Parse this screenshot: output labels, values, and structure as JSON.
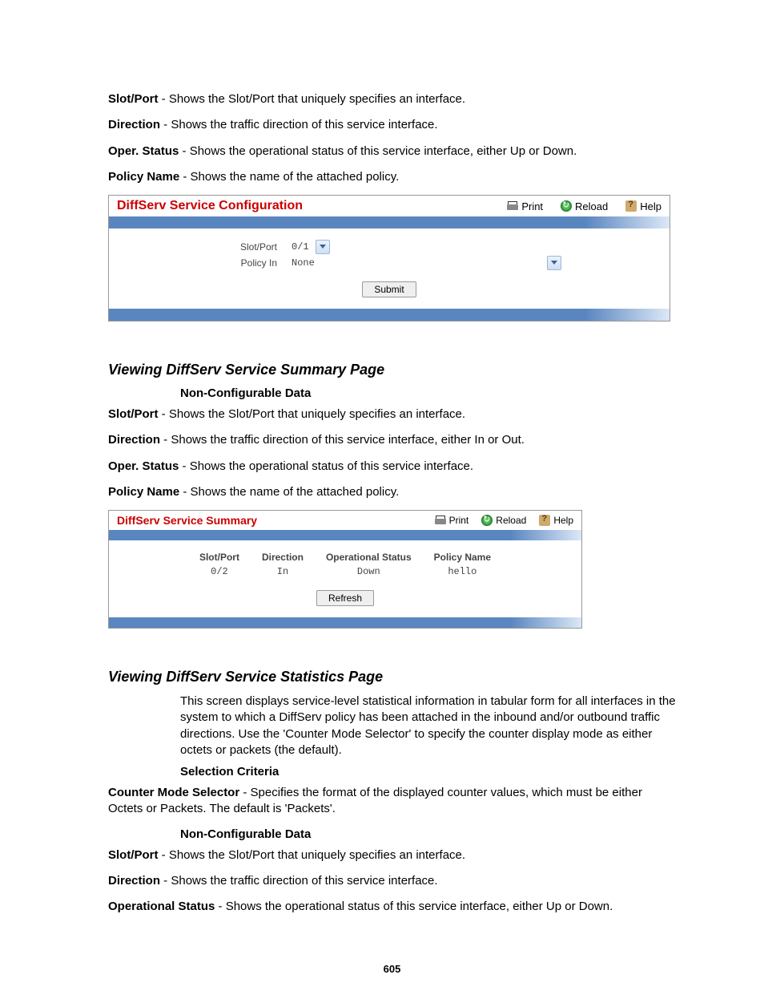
{
  "defs1": [
    {
      "term": "Slot/Port",
      "desc": " - Shows the Slot/Port that uniquely specifies an interface."
    },
    {
      "term": "Direction",
      "desc": " - Shows the traffic direction of this service interface."
    },
    {
      "term": "Oper. Status",
      "desc": " - Shows the operational status of this service interface, either Up or Down."
    },
    {
      "term": "Policy Name",
      "desc": " - Shows the name of the attached policy."
    }
  ],
  "panel_config": {
    "title": "DiffServ Service Configuration",
    "actions": {
      "print": "Print",
      "reload": "Reload",
      "help": "Help"
    },
    "rows": {
      "slotport_label": "Slot/Port",
      "slotport_value": "0/1",
      "policyin_label": "Policy In",
      "policyin_value": "None"
    },
    "submit": "Submit"
  },
  "section_summary": {
    "heading": "Viewing DiffServ Service Summary Page",
    "subhead": "Non-Configurable Data",
    "defs": [
      {
        "term": "Slot/Port",
        "desc": " - Shows the Slot/Port that uniquely specifies an interface."
      },
      {
        "term": "Direction",
        "desc": " - Shows the traffic direction of this service interface, either In or Out."
      },
      {
        "term": "Oper. Status",
        "desc": " - Shows the operational status of this service interface."
      },
      {
        "term": "Policy Name",
        "desc": " - Shows the name of the attached policy."
      }
    ]
  },
  "panel_summary": {
    "title": "DiffServ Service Summary",
    "actions": {
      "print": "Print",
      "reload": "Reload",
      "help": "Help"
    },
    "headers": {
      "c1": "Slot/Port",
      "c2": "Direction",
      "c3": "Operational Status",
      "c4": "Policy Name"
    },
    "row": {
      "c1": "0/2",
      "c2": "In",
      "c3": "Down",
      "c4": "hello"
    },
    "refresh": "Refresh"
  },
  "section_stats": {
    "heading": "Viewing DiffServ Service Statistics Page",
    "intro": "This screen displays service-level statistical information in tabular form for all interfaces in the system to which a DiffServ policy has been attached in the inbound and/or outbound traffic directions. Use the 'Counter Mode Selector' to specify the counter display mode as either octets or packets (the default).",
    "selection_head": "Selection Criteria",
    "selection_def": {
      "term": "Counter Mode Selector",
      "desc": " - Specifies the format of the displayed counter values, which must be either Octets or Packets. The default is 'Packets'."
    },
    "noncfg_head": "Non-Configurable Data",
    "defs": [
      {
        "term": "Slot/Port",
        "desc": " - Shows the Slot/Port that uniquely specifies an interface."
      },
      {
        "term": "Direction",
        "desc": " - Shows the traffic direction of this service interface."
      },
      {
        "term": "Operational Status",
        "desc": " - Shows the operational status of this service interface, either Up or Down."
      }
    ]
  },
  "page_number": "605"
}
